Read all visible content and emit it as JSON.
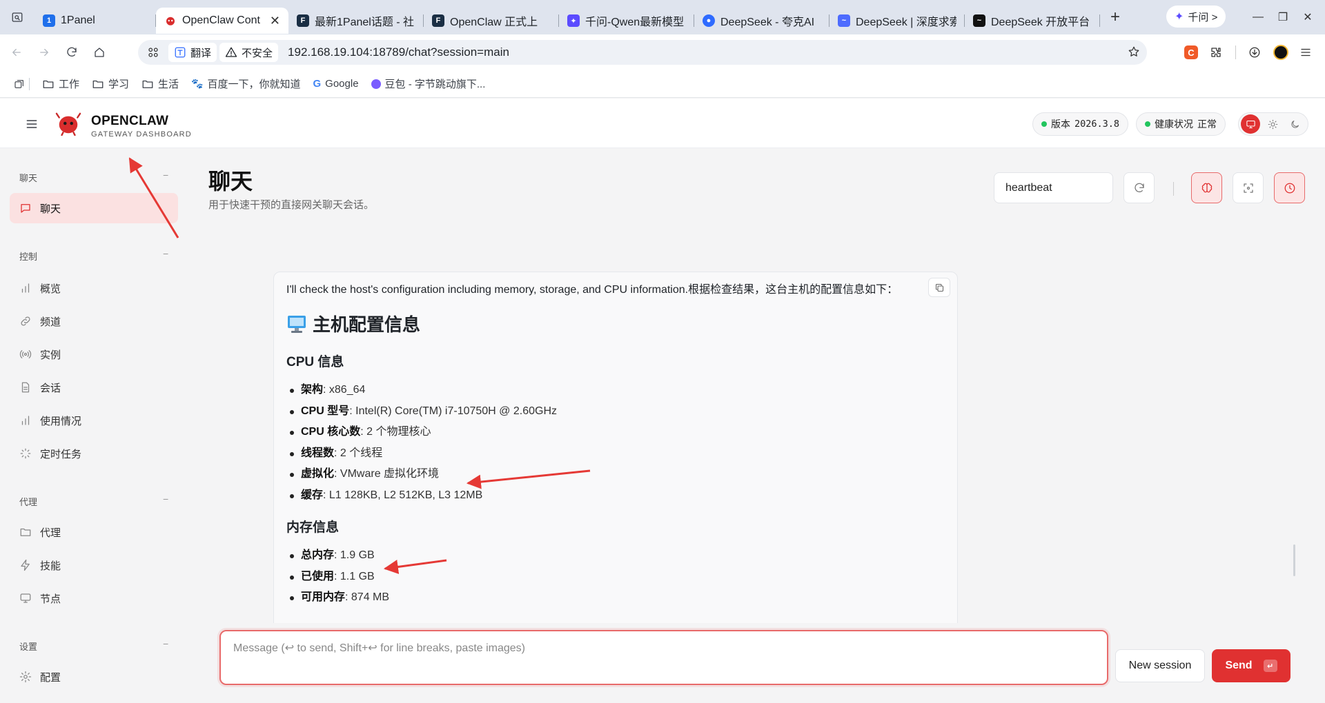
{
  "browser": {
    "tabs": [
      {
        "label": "1Panel"
      },
      {
        "label": "OpenClaw Cont",
        "active": true
      },
      {
        "label": "最新1Panel话题 - 社"
      },
      {
        "label": "OpenClaw 正式上"
      },
      {
        "label": "千问-Qwen最新模型"
      },
      {
        "label": "DeepSeek - 夸克AI"
      },
      {
        "label": "DeepSeek | 深度求索"
      },
      {
        "label": "DeepSeek 开放平台"
      }
    ],
    "qianwen_button": "千问 >",
    "url": "192.168.19.104:18789/chat?session=main",
    "translate_chip": "翻译",
    "insecure_chip": "不安全",
    "bookmarks": [
      "工作",
      "学习",
      "生活",
      "百度一下，你就知道",
      "Google",
      "豆包 - 字节跳动旗下..."
    ]
  },
  "header": {
    "brand": "OPENCLAW",
    "brand_sub": "GATEWAY DASHBOARD",
    "version_label": "版本",
    "version_value": "2026.3.8",
    "health_label": "健康状况",
    "health_value": "正常"
  },
  "sidebar": {
    "groups": [
      {
        "title": "聊天",
        "toggle": "−",
        "items": [
          {
            "label": "聊天",
            "icon": "chat-icon",
            "active": true
          }
        ]
      },
      {
        "title": "控制",
        "toggle": "−",
        "items": [
          {
            "label": "概览",
            "icon": "bar-chart-icon"
          },
          {
            "label": "频道",
            "icon": "link-icon"
          },
          {
            "label": "实例",
            "icon": "broadcast-icon"
          },
          {
            "label": "会话",
            "icon": "document-icon"
          },
          {
            "label": "使用情况",
            "icon": "bar-chart-icon"
          },
          {
            "label": "定时任务",
            "icon": "loader-icon"
          }
        ]
      },
      {
        "title": "代理",
        "toggle": "−",
        "items": [
          {
            "label": "代理",
            "icon": "folder-icon"
          },
          {
            "label": "技能",
            "icon": "zap-icon"
          },
          {
            "label": "节点",
            "icon": "monitor-icon"
          }
        ]
      },
      {
        "title": "设置",
        "toggle": "−",
        "items": [
          {
            "label": "配置",
            "icon": "gear-icon"
          }
        ]
      }
    ]
  },
  "main": {
    "title": "聊天",
    "subtitle": "用于快速干预的直接网关聊天会话。",
    "session_value": "heartbeat"
  },
  "message": {
    "intro": "I'll check the host's configuration including memory, storage, and CPU information.根据检查结果，这台主机的配置信息如下：",
    "heading": "主机配置信息",
    "cpu_heading": "CPU 信息",
    "cpu_items": [
      {
        "key": "架构",
        "value": ": x86_64"
      },
      {
        "key": "CPU 型号",
        "value": ": Intel(R) Core(TM) i7-10750H @ 2.60GHz"
      },
      {
        "key": "CPU 核心数",
        "value": ": 2 个物理核心"
      },
      {
        "key": "线程数",
        "value": ": 2 个线程"
      },
      {
        "key": "虚拟化",
        "value": ": VMware 虚拟化环境"
      },
      {
        "key": "缓存",
        "value": ": L1 128KB, L2 512KB, L3 12MB"
      }
    ],
    "mem_heading": "内存信息",
    "mem_items": [
      {
        "key": "总内存",
        "value": ": 1.9 GB"
      },
      {
        "key": "已使用",
        "value": ": 1.1 GB"
      },
      {
        "key": "可用内存",
        "value": ": 874 MB"
      }
    ]
  },
  "composer": {
    "placeholder": "Message (↩ to send, Shift+↩ for line breaks, paste images)",
    "new_session": "New session",
    "send": "Send",
    "send_key": "↵"
  },
  "colors": {
    "accent": "#e03131",
    "accent_soft": "#fbe1e1",
    "ok": "#22c55e",
    "annotation": "#e53935"
  }
}
